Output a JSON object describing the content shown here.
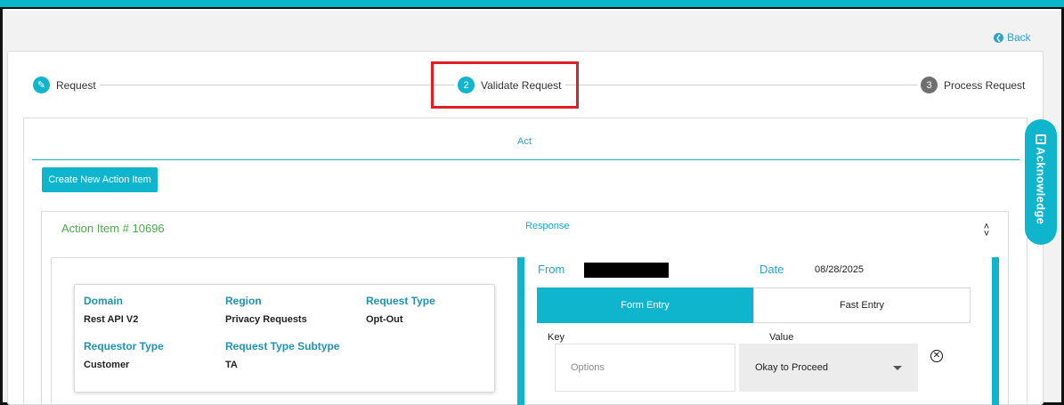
{
  "header": {
    "back_label": "Back"
  },
  "stepper": {
    "steps": [
      {
        "number": "",
        "label": "Request",
        "icon": "pencil-icon"
      },
      {
        "number": "2",
        "label": "Validate Request"
      },
      {
        "number": "3",
        "label": "Process Request"
      }
    ]
  },
  "tabs": {
    "act_label": "Act"
  },
  "toolbar": {
    "create_label": "Create New Action Item"
  },
  "side_tab": {
    "label": "Acknowledge"
  },
  "action_item": {
    "title": "Action Item # 10696",
    "response_label": "Response",
    "details": {
      "domain_label": "Domain",
      "domain_value": "Rest API V2",
      "region_label": "Region",
      "region_value": "Privacy Requests",
      "request_type_label": "Request Type",
      "request_type_value": "Opt-Out",
      "requestor_type_label": "Requestor Type",
      "requestor_type_value": "Customer",
      "request_subtype_label": "Request Type Subtype",
      "request_subtype_value": "TA"
    },
    "response": {
      "from_label": "From",
      "date_label": "Date",
      "date_value": "08/28/2025",
      "form_entry_label": "Form Entry",
      "fast_entry_label": "Fast Entry",
      "key_label": "Key",
      "value_label": "Value",
      "key_placeholder": "Options",
      "value_selected": "Okay to Proceed"
    }
  },
  "colors": {
    "accent": "#0fb5cd",
    "link": "#22a7c9",
    "success": "#4ca94b",
    "highlight": "#e01e26"
  }
}
